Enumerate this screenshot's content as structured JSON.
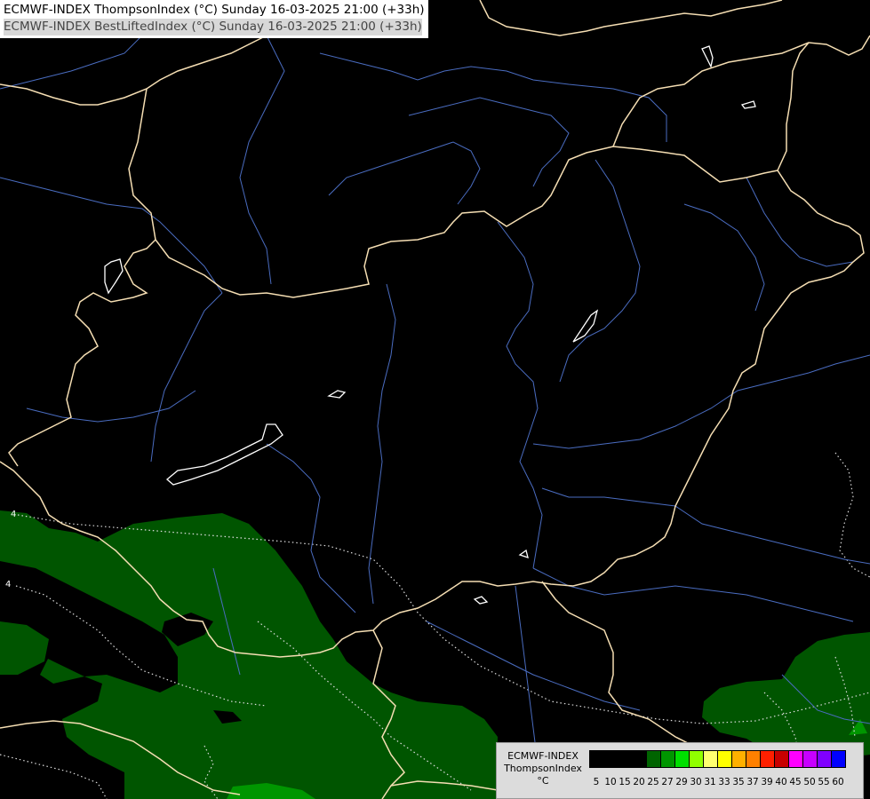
{
  "title": {
    "line1": "ECMWF-INDEX ThompsonIndex (°C) Sunday 16-03-2025 21:00 (+33h)",
    "line2": "ECMWF-INDEX BestLiftedIndex (°C) Sunday 16-03-2025 21:00 (+33h)"
  },
  "contour_labels": [
    "4",
    "4"
  ],
  "legend": {
    "line1": "ECMWF-INDEX",
    "line2": "ThompsonIndex",
    "unit": "°C",
    "ticks": [
      "5",
      "10",
      "15",
      "20",
      "25",
      "27",
      "29",
      "30",
      "31",
      "33",
      "35",
      "37",
      "39",
      "40",
      "45",
      "50",
      "55",
      "60"
    ],
    "colors": [
      "#000000",
      "#000000",
      "#000000",
      "#000000",
      "#006400",
      "#009600",
      "#00e000",
      "#90ff00",
      "#ffff70",
      "#ffff00",
      "#ffb000",
      "#ff8000",
      "#ff2000",
      "#c80000",
      "#ff00ff",
      "#c800ff",
      "#8000ff",
      "#0000ff"
    ]
  },
  "colors": {
    "background": "#000000",
    "border": "#f5deb3",
    "river": "#4a6cc0",
    "lake": "#ffffff",
    "fill_dark_green": "#005500",
    "fill_bright_green": "#009600"
  }
}
